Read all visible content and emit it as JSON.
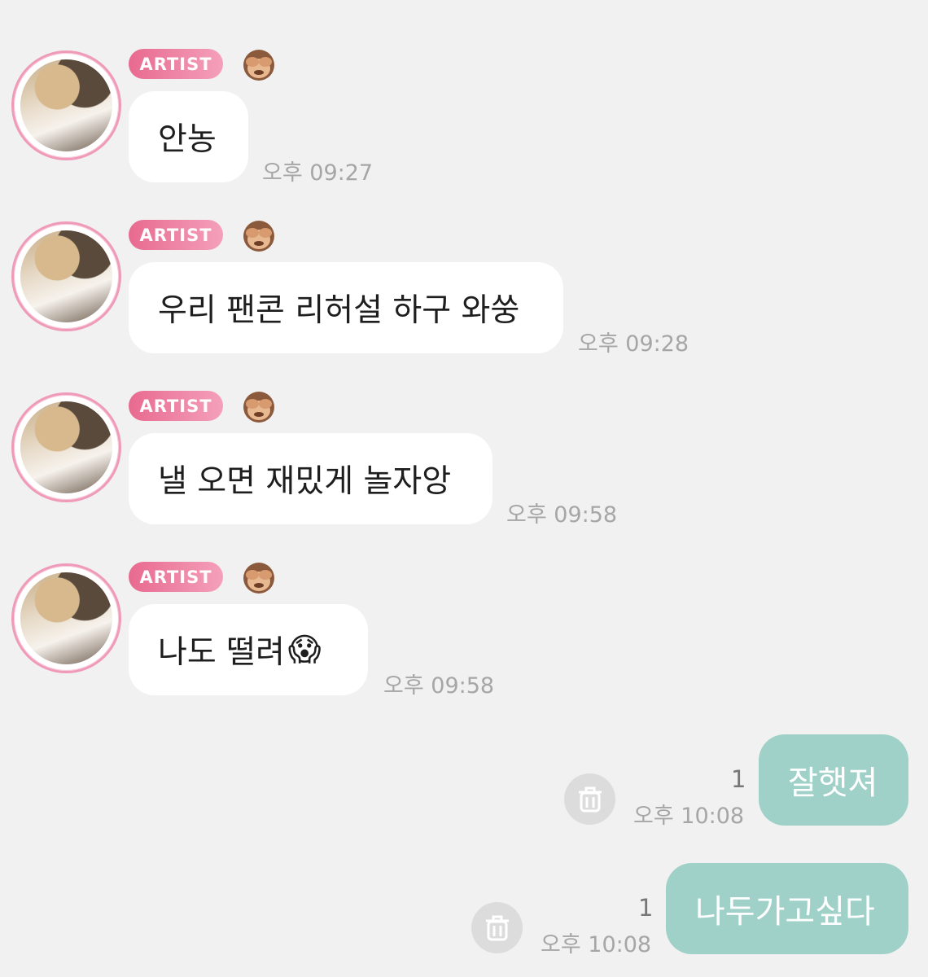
{
  "incoming": [
    {
      "badge": "ARTIST",
      "text": "안농",
      "time": "오후 09:27"
    },
    {
      "badge": "ARTIST",
      "text": "우리 팬콘 리허설 하구 와쑹",
      "time": "오후 09:28"
    },
    {
      "badge": "ARTIST",
      "text": "낼 오면 재밌게 놀자앙",
      "time": "오후 09:58"
    },
    {
      "badge": "ARTIST",
      "text": "나도 떨려",
      "emoji": "😱",
      "time": "오후 09:58"
    }
  ],
  "outgoing": [
    {
      "text": "잘햇져",
      "read_count": "1",
      "time": "오후 10:08"
    },
    {
      "text": "나두가고싶다",
      "read_count": "1",
      "time": "오후 10:08"
    }
  ],
  "icons": {
    "badge_emoji": "see-no-evil-monkey",
    "delete": "trash-icon"
  },
  "colors": {
    "background": "#f1f1f1",
    "artist_badge": "#e86a8f",
    "outgoing_bubble": "#9fd1c9"
  }
}
